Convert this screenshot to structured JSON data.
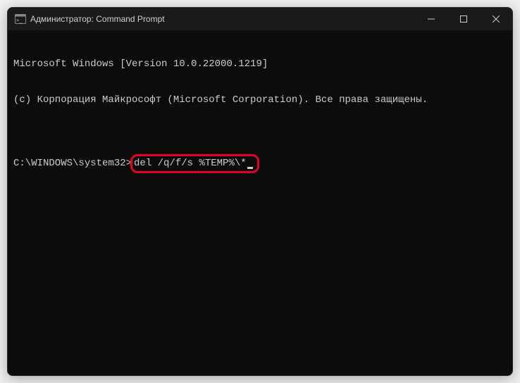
{
  "titlebar": {
    "title": "Администратор: Command Prompt"
  },
  "terminal": {
    "line1": "Microsoft Windows [Version 10.0.22000.1219]",
    "line2": "(c) Корпорация Майкрософт (Microsoft Corporation). Все права защищены.",
    "blank": "",
    "prompt": "C:\\WINDOWS\\system32>",
    "command": "del /q/f/s %TEMP%\\*"
  }
}
